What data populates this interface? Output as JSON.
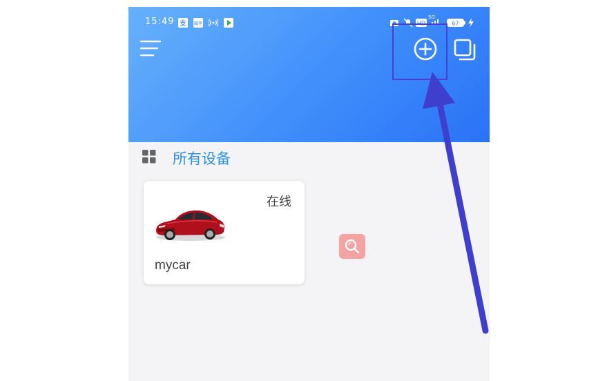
{
  "status_bar": {
    "time": "15:49",
    "network": "5G",
    "battery": "67",
    "icons": [
      "alipay-icon",
      "zhihu-icon",
      "hotspot-icon",
      "app-icon",
      "camera-icon",
      "mute-icon",
      "hd-icon",
      "signal-icon",
      "battery-icon",
      "charging-icon"
    ]
  },
  "header": {
    "menu_icon": "menu-icon",
    "add_icon": "add-circle-icon",
    "copy_icon": "copy-icon",
    "background_start": "#66b1fb",
    "background_end": "#2a72f7"
  },
  "section": {
    "title": "所有设备",
    "icon": "grid-icon",
    "title_color": "#2d8fe0"
  },
  "devices": [
    {
      "name": "mycar",
      "status": "在线",
      "image": "red-car-image"
    }
  ],
  "search_fab": {
    "icon": "search-icon",
    "color": "#f2a3a2"
  },
  "annotation": {
    "arrow_color": "#3f3fce",
    "highlight_target": "add-circle-icon"
  }
}
